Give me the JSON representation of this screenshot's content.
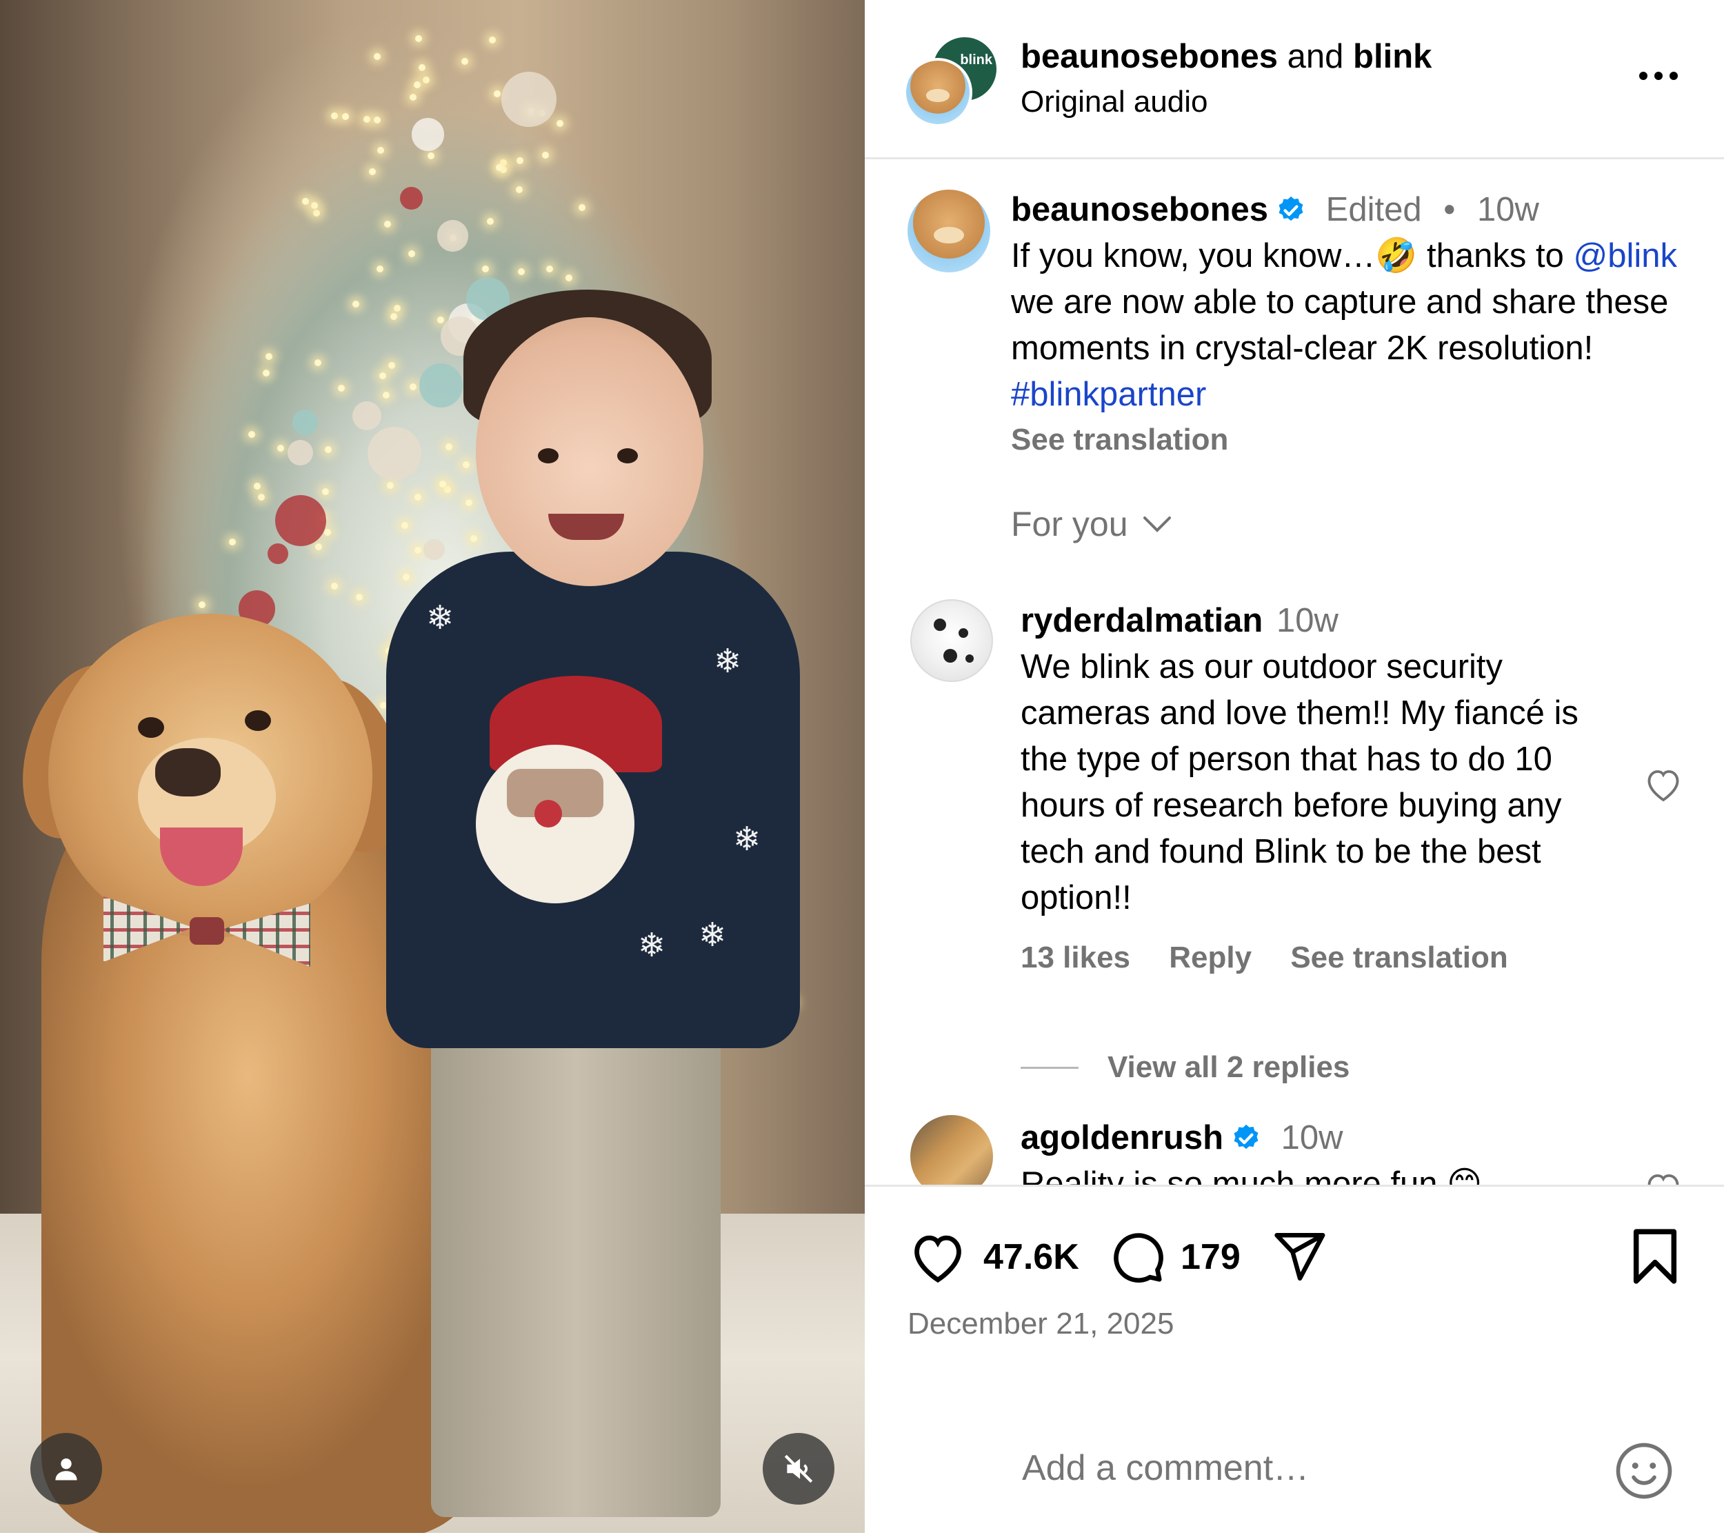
{
  "post": {
    "header": {
      "author": "beaunosebones",
      "conjunction": "and",
      "collaborator": "blink",
      "collab_avatar_text": "blink",
      "audio": "Original audio"
    },
    "caption": {
      "author": "beaunosebones",
      "edited": "Edited",
      "separator": "•",
      "time": "10w",
      "text_part1": "If you know, you know…🤣 thanks to",
      "mention": "@blink",
      "text_part2": "we are now able to capture and share these moments in crystal-clear 2K resolution!",
      "hashtag": "#blinkpartner",
      "see_translation": "See translation"
    },
    "filter": {
      "label": "For you",
      "icon": "chevron-down-icon"
    },
    "comments": [
      {
        "author": "ryderdalmatian",
        "time": "10w",
        "verified": false,
        "text": "We blink as our outdoor security cameras and love them!! My fiancé is the type of person that has to do 10 hours of research before buying any tech and found Blink to be the best option!!",
        "likes": "13 likes",
        "reply": "Reply",
        "see_translation": "See translation",
        "view_replies": "View all 2 replies"
      },
      {
        "author": "agoldenrush",
        "time": "10w",
        "verified": true,
        "text": "Reality is so much more fun 😊"
      }
    ],
    "actions": {
      "likes_count": "47.6K",
      "comments_count": "179",
      "date": "December 21, 2025",
      "add_comment_placeholder": "Add a comment…"
    },
    "colors": {
      "link": "#1a45c9",
      "verified": "#0095f6",
      "secondary_text": "#737373",
      "divider": "#e6e6e6"
    }
  }
}
